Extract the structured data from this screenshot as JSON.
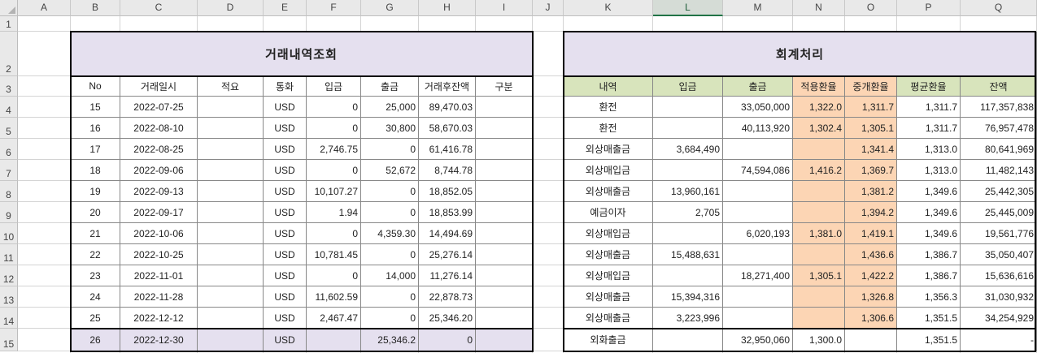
{
  "spreadsheet": {
    "columns": [
      "A",
      "B",
      "C",
      "D",
      "E",
      "F",
      "G",
      "H",
      "I",
      "J",
      "K",
      "L",
      "M",
      "N",
      "O",
      "P",
      "Q"
    ],
    "selected_column": "L",
    "rows": [
      "1",
      "2",
      "3",
      "4",
      "5",
      "6",
      "7",
      "8",
      "9",
      "10",
      "11",
      "12",
      "13",
      "14",
      "15"
    ]
  },
  "left_table": {
    "title": "거래내역조회",
    "headers": [
      "No",
      "거래일시",
      "적요",
      "통화",
      "입금",
      "출금",
      "거래후잔액",
      "구분"
    ],
    "rows": [
      [
        "15",
        "2022-07-25",
        "",
        "USD",
        "0",
        "25,000",
        "89,470.03",
        ""
      ],
      [
        "16",
        "2022-08-10",
        "",
        "USD",
        "0",
        "30,800",
        "58,670.03",
        ""
      ],
      [
        "17",
        "2022-08-25",
        "",
        "USD",
        "2,746.75",
        "0",
        "61,416.78",
        ""
      ],
      [
        "18",
        "2022-09-06",
        "",
        "USD",
        "0",
        "52,672",
        "8,744.78",
        ""
      ],
      [
        "19",
        "2022-09-13",
        "",
        "USD",
        "10,107.27",
        "0",
        "18,852.05",
        ""
      ],
      [
        "20",
        "2022-09-17",
        "",
        "USD",
        "1.94",
        "0",
        "18,853.99",
        ""
      ],
      [
        "21",
        "2022-10-06",
        "",
        "USD",
        "0",
        "4,359.30",
        "14,494.69",
        ""
      ],
      [
        "22",
        "2022-10-25",
        "",
        "USD",
        "10,781.45",
        "0",
        "25,276.14",
        ""
      ],
      [
        "23",
        "2022-11-01",
        "",
        "USD",
        "0",
        "14,000",
        "11,276.14",
        ""
      ],
      [
        "24",
        "2022-11-28",
        "",
        "USD",
        "11,602.59",
        "0",
        "22,878.73",
        ""
      ],
      [
        "25",
        "2022-12-12",
        "",
        "USD",
        "2,467.47",
        "0",
        "25,346.20",
        ""
      ],
      [
        "26",
        "2022-12-30",
        "",
        "USD",
        "",
        "25,346.2",
        "0",
        ""
      ]
    ]
  },
  "right_table": {
    "title": "회계처리",
    "headers": [
      "내역",
      "입금",
      "출금",
      "적용환율",
      "중개환율",
      "평균환율",
      "잔액"
    ],
    "rows": [
      [
        "환전",
        "",
        "33,050,000",
        "1,322.0",
        "1,311.7",
        "1,311.7",
        "117,357,838"
      ],
      [
        "환전",
        "",
        "40,113,920",
        "1,302.4",
        "1,305.1",
        "1,311.7",
        "76,957,478"
      ],
      [
        "외상매출금",
        "3,684,490",
        "",
        "",
        "1,341.4",
        "1,313.0",
        "80,641,969"
      ],
      [
        "외상매입금",
        "",
        "74,594,086",
        "1,416.2",
        "1,369.7",
        "1,313.0",
        "11,482,143"
      ],
      [
        "외상매출금",
        "13,960,161",
        "",
        "",
        "1,381.2",
        "1,349.6",
        "25,442,305"
      ],
      [
        "예금이자",
        "2,705",
        "",
        "",
        "1,394.2",
        "1,349.6",
        "25,445,009"
      ],
      [
        "외상매입금",
        "",
        "6,020,193",
        "1,381.0",
        "1,419.1",
        "1,349.6",
        "19,561,776"
      ],
      [
        "외상매출금",
        "15,488,631",
        "",
        "",
        "1,436.6",
        "1,386.7",
        "35,050,407"
      ],
      [
        "외상매입금",
        "",
        "18,271,400",
        "1,305.1",
        "1,422.2",
        "1,386.7",
        "15,636,616"
      ],
      [
        "외상매출금",
        "15,394,316",
        "",
        "",
        "1,326.8",
        "1,356.3",
        "31,030,932"
      ],
      [
        "외상매출금",
        "3,223,996",
        "",
        "",
        "1,306.6",
        "1,351.5",
        "34,254,929"
      ],
      [
        "외화출금",
        "",
        "32,950,060",
        "1,300.0",
        "",
        "1,351.5",
        "-"
      ]
    ]
  },
  "colors": {
    "title_fill": "#e5e0ef",
    "header_green": "#d8e4bc",
    "header_orange": "#fcd5b4",
    "grid": "#d4d4d4",
    "border": "#000000"
  }
}
